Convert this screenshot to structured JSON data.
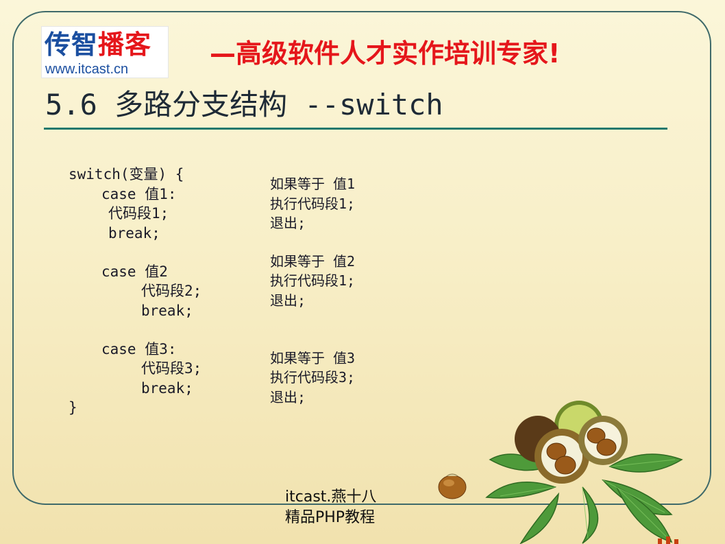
{
  "header": {
    "logo_name": "传智播客",
    "logo_url_text": "www.itcast.cn",
    "slogan": "—高级软件人才实作培训专家!"
  },
  "slide": {
    "title": "5.6 多路分支结构 --switch"
  },
  "code_lines": [
    "switch(变量) {",
    "case 值1:",
    "代码段1;",
    "break;",
    "case 值2",
    "代码段2;",
    "break;",
    "case 值3:",
    "代码段3;",
    "break;",
    "}"
  ],
  "notes": [
    {
      "line1": "如果等于 值1",
      "line2": "执行代码段1;",
      "line3": "退出;"
    },
    {
      "line1": "如果等于 值2",
      "line2": "执行代码段1;",
      "line3": "退出;"
    },
    {
      "line1": "如果等于 值3",
      "line2": "执行代码段3;",
      "line3": "退出;"
    }
  ],
  "footer": {
    "line1": "itcast.燕十八",
    "line2": "精品PHP教程"
  },
  "colors": {
    "frame": "#3f6a6a",
    "slogan": "#e5161b",
    "logo_blue": "#1b4fa0",
    "rule": "#22786d"
  },
  "icons": [
    "chestnut-cluster-decoration",
    "chestnut-icon"
  ]
}
